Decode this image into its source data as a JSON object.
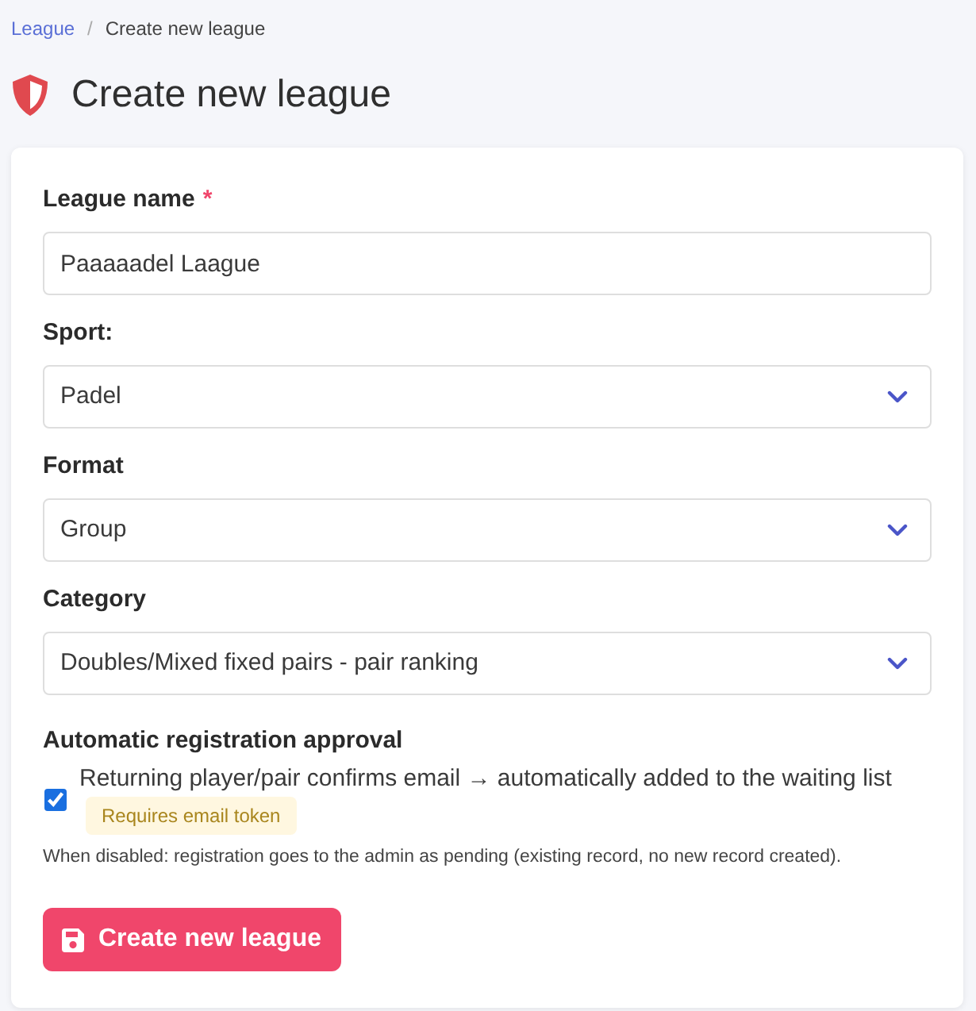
{
  "breadcrumb": {
    "separator": "/",
    "items": [
      {
        "kind": "link",
        "label": "League"
      },
      {
        "kind": "current",
        "label": "Create new league"
      }
    ]
  },
  "page_title": "Create new league",
  "fields": [
    {
      "kind": "text",
      "label": "League name",
      "required_mark": "*",
      "value": "Paaaaadel Laague"
    },
    {
      "kind": "select",
      "label": "Sport:",
      "value": "Padel"
    },
    {
      "kind": "select",
      "label": "Format",
      "value": "Group"
    },
    {
      "kind": "select",
      "label": "Category",
      "value": "Doubles/Mixed fixed pairs - pair ranking"
    }
  ],
  "approval": {
    "heading": "Automatic registration approval",
    "checked": true,
    "label": "Returning player/pair confirms email → automatically added to the waiting list",
    "badge": "Requires email token",
    "help": "When disabled: registration goes to the admin as pending (existing record, no new record created)."
  },
  "submit_button": {
    "label": "Create new league"
  }
}
